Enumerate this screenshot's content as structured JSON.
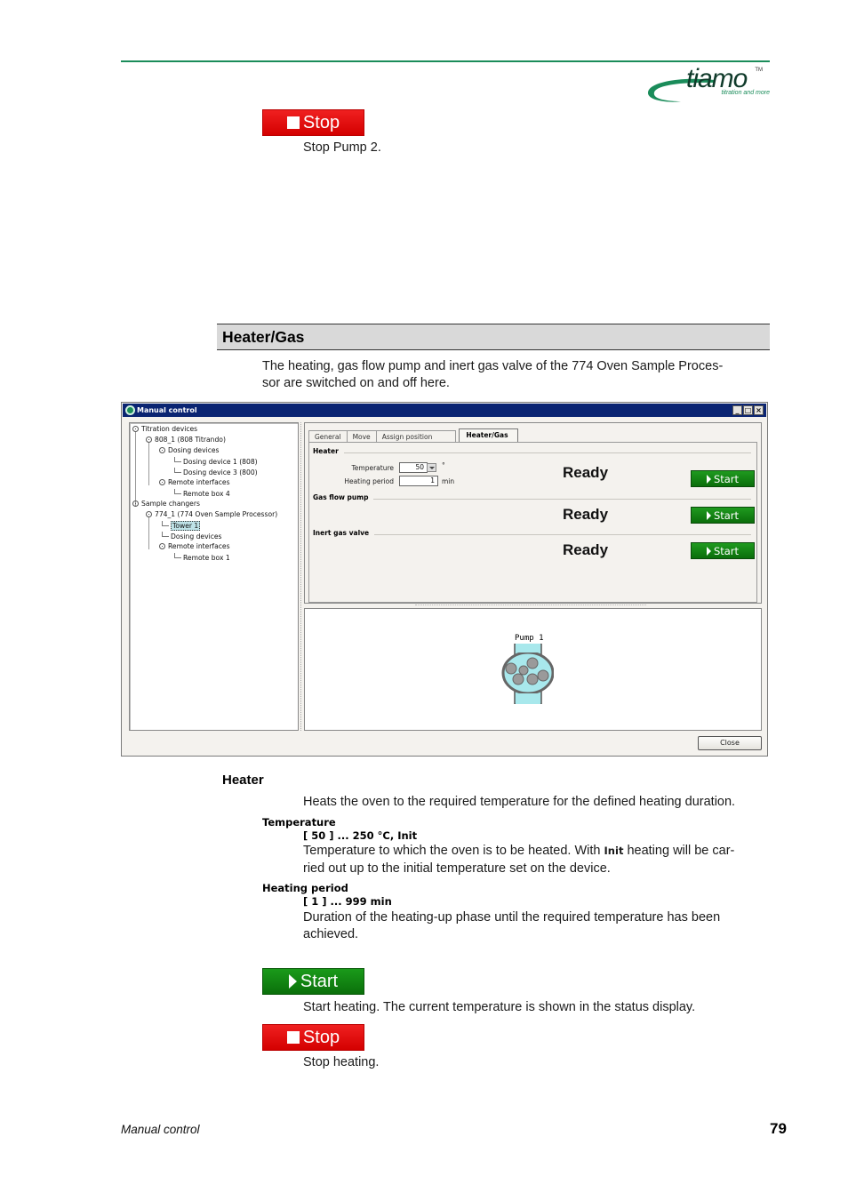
{
  "header": {
    "logo": {
      "word": "tiamo",
      "trademark": "TM",
      "tagline": "titration and more"
    }
  },
  "colors": {
    "brand_green": "#1a8c5a",
    "stop_red": "#e00000",
    "start_green": "#108010",
    "titlebar_blue": "#0a2472",
    "section_bg": "#d9d9d9"
  },
  "top": {
    "stop_button": {
      "label": "Stop",
      "icon": "stop-square-icon"
    },
    "stop_desc": "Stop Pump 2."
  },
  "section": {
    "title": "Heater/Gas",
    "intro_line1": "The heating, gas flow pump and inert gas valve of the 774 Oven Sample Proces-",
    "intro_line2": "sor are switched on and off here."
  },
  "window": {
    "title": "Manual control",
    "controls": {
      "minimize": "_",
      "maximize": "□",
      "close": "×"
    },
    "tree": [
      {
        "label": "Titration devices",
        "type": "node"
      },
      {
        "label": "808_1 (808 Titrando)",
        "type": "node"
      },
      {
        "label": "Dosing devices",
        "type": "node"
      },
      {
        "label": "Dosing device 1 (808)",
        "type": "leaf"
      },
      {
        "label": "Dosing device 3 (800)",
        "type": "leaf"
      },
      {
        "label": "Remote interfaces",
        "type": "node"
      },
      {
        "label": "Remote box 4",
        "type": "leaf"
      },
      {
        "label": "Sample changers",
        "type": "node"
      },
      {
        "label": "774_1 (774 Oven Sample Processor)",
        "type": "node"
      },
      {
        "label": "Tower 1",
        "type": "leaf",
        "selected": true
      },
      {
        "label": "Dosing devices",
        "type": "leaf"
      },
      {
        "label": "Remote interfaces",
        "type": "node"
      },
      {
        "label": "Remote box 1",
        "type": "leaf"
      }
    ],
    "tabs": [
      {
        "label": "General",
        "active": false
      },
      {
        "label": "Move",
        "active": false
      },
      {
        "label": "Assign position",
        "active": false
      },
      {
        "label": "Heater/Gas",
        "active": true
      }
    ],
    "heater": {
      "group_label": "Heater",
      "temperature_label": "Temperature",
      "temperature_value": "50",
      "temperature_unit": "°",
      "period_label": "Heating period",
      "period_value": "1",
      "period_unit": "min",
      "status": "Ready",
      "start_label": "Start"
    },
    "gas_flow_pump": {
      "group_label": "Gas flow pump",
      "status": "Ready",
      "start_label": "Start"
    },
    "inert_gas_valve": {
      "group_label": "Inert gas valve",
      "status": "Ready",
      "start_label": "Start"
    },
    "pump_display": {
      "label": "Pump 1"
    },
    "close_label": "Close"
  },
  "heater_doc": {
    "heading": "Heater",
    "description": "Heats the oven to the required temperature for the defined heating duration.",
    "temperature": {
      "name": "Temperature",
      "range": "[ 50 ] ... 250 °C, Init",
      "desc_before": "Temperature to which the oven is to be heated. With ",
      "desc_bold": "Init",
      "desc_after": " heating will be car-",
      "desc_line2": "ried out up to the initial temperature set on the device."
    },
    "heating_period": {
      "name": "Heating period",
      "range": "[ 1 ] ... 999 min",
      "desc_line1": "Duration of the heating-up phase until the required temperature has been",
      "desc_line2": "achieved."
    },
    "start_button": {
      "label": "Start",
      "icon": "play-triangle-icon"
    },
    "start_desc": "Start heating. The current temperature is shown in the status display.",
    "stop_button": {
      "label": "Stop",
      "icon": "stop-square-icon"
    },
    "stop_desc": "Stop heating."
  },
  "footer": {
    "section_name": "Manual control",
    "page_number": "79"
  }
}
